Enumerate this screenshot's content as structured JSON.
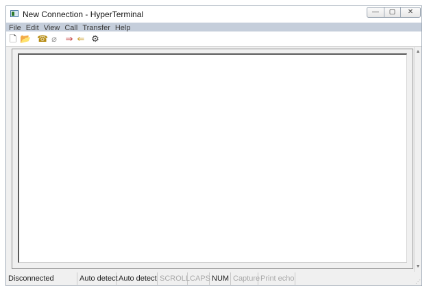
{
  "window": {
    "title": "New Connection - HyperTerminal",
    "controls": {
      "minimize": "—",
      "maximize": "▢",
      "close": "✕"
    }
  },
  "menubar": {
    "items": [
      "File",
      "Edit",
      "View",
      "Call",
      "Transfer",
      "Help"
    ]
  },
  "toolbar": {
    "icons": {
      "new": "🗋",
      "open": "📂",
      "connect": "☎",
      "disconnect": "⌀",
      "send": "⇒",
      "receive": "⇐",
      "properties": "⚙"
    }
  },
  "scrollbar": {
    "up": "▲",
    "down": "▼"
  },
  "statusbar": {
    "status": "Disconnected",
    "detect1": "Auto detect",
    "detect2": "Auto detect",
    "scroll": "SCROLL",
    "caps": "CAPS",
    "num": "NUM",
    "capture": "Capture",
    "print_echo": "Print echo",
    "grip": "⋰"
  }
}
